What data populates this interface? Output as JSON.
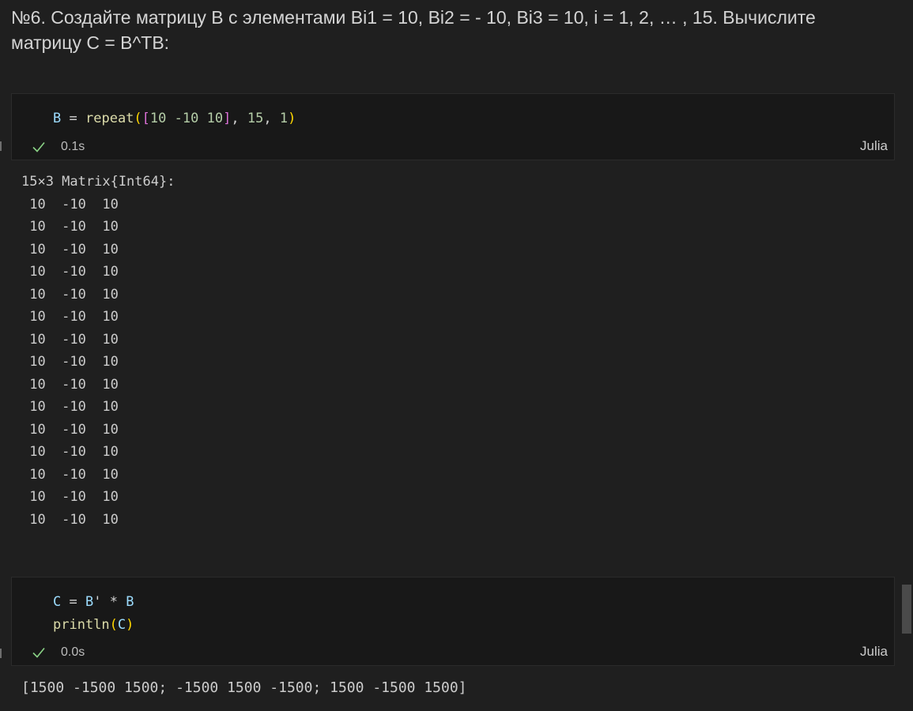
{
  "markdown": {
    "text": "№6. Создайте матрицу B с элементами Bi1 = 10, Bi2 = - 10, Bi3 = 10, i = 1, 2, … , 15. Вычислите матрицу C = B^TB:"
  },
  "cell1": {
    "code_lines": [
      "B = repeat([10 -10 10], 15, 1)"
    ],
    "status": "0.1s",
    "language": "Julia",
    "output": {
      "header": "15×3 Matrix{Int64}:",
      "rows": [
        " 10  -10  10",
        " 10  -10  10",
        " 10  -10  10",
        " 10  -10  10",
        " 10  -10  10",
        " 10  -10  10",
        " 10  -10  10",
        " 10  -10  10",
        " 10  -10  10",
        " 10  -10  10",
        " 10  -10  10",
        " 10  -10  10",
        " 10  -10  10",
        " 10  -10  10",
        " 10  -10  10"
      ]
    }
  },
  "cell2": {
    "code_lines": [
      "C = B' * B",
      "println(C)"
    ],
    "status": "0.0s",
    "language": "Julia",
    "output": "[1500 -1500 1500; -1500 1500 -1500; 1500 -1500 1500]"
  },
  "icons": {
    "success": "check-icon"
  },
  "colors": {
    "background": "#1f1f1f",
    "cell_background": "#181818",
    "success": "#89d185",
    "function": "#dcdcaa",
    "number": "#b5cea8"
  }
}
